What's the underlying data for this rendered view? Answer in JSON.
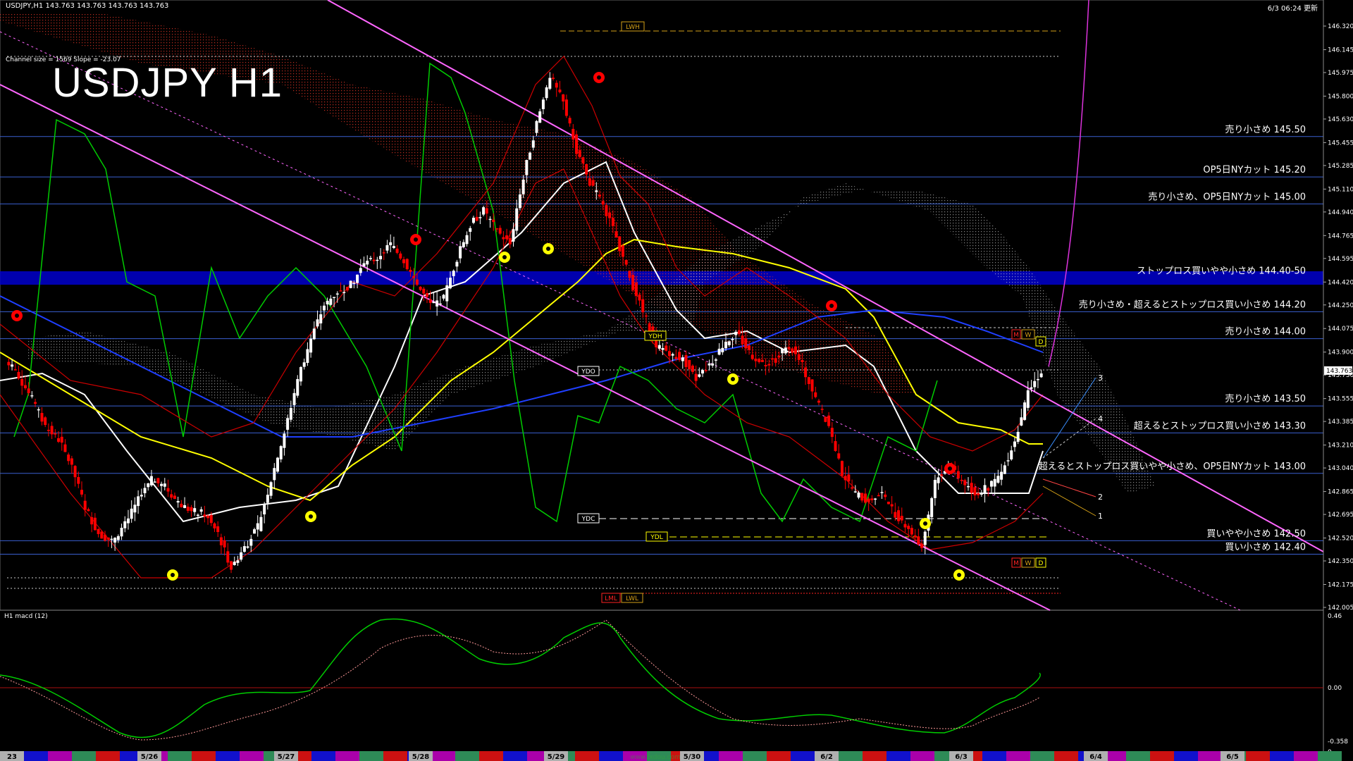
{
  "header": {
    "symbol_info": "USDJPY,H1  143.763 143.763 143.763 143.763",
    "timestamp": "6/3 06:24 更新"
  },
  "overlay": {
    "title": "USDJPY H1",
    "channel_info": "Channel size = 1569 Slope = -23.07",
    "macd_title": "H1  macd (12)"
  },
  "colors": {
    "background": "#000000",
    "bull": "#ffffff",
    "bear": "#ff0000",
    "level_line": "#2a4fbf",
    "band": "#0000cc",
    "channel": "#ff66ff",
    "ma_white": "#ffffff",
    "ma_yellow": "#ffff00",
    "ma_blue": "#1f3fff",
    "cloud_red": "#ff3a2a",
    "cloud_white": "#e0e0e0",
    "lagging": "#00cc00",
    "bollinger": "#cc0000"
  },
  "price_axis": {
    "ticks": [
      "146.320",
      "146.145",
      "145.975",
      "145.800",
      "145.630",
      "145.455",
      "145.285",
      "145.110",
      "144.940",
      "144.765",
      "144.595",
      "144.420",
      "144.250",
      "144.075",
      "143.900",
      "143.730",
      "143.555",
      "143.385",
      "143.210",
      "143.040",
      "142.865",
      "142.695",
      "142.520",
      "142.350",
      "142.175",
      "142.005"
    ],
    "current_price": "143.763"
  },
  "macd_axis": {
    "ticks": [
      "0.46",
      "0.00",
      "-0.358",
      "0"
    ]
  },
  "date_axis": {
    "labels": [
      "23",
      "5/26",
      "5/27",
      "5/28",
      "5/29",
      "5/30",
      "6/2",
      "6/3",
      "6/4",
      "6/5"
    ],
    "faded_label": "www.fxdou.com"
  },
  "levels": [
    {
      "label": "売り小さめ 145.50",
      "price": 145.5
    },
    {
      "label": "OP5日NYカット 145.20",
      "price": 145.2
    },
    {
      "label": "売り小さめ、OP5日NYカット 145.00",
      "price": 145.0
    },
    {
      "label": "ストップロス買いやや小さめ 144.40-50",
      "price": 144.45
    },
    {
      "label": "売り小さめ・超えるとストップロス買い小さめ 144.20",
      "price": 144.2
    },
    {
      "label": "売り小さめ 144.00",
      "price": 144.0
    },
    {
      "label": "売り小さめ 143.50",
      "price": 143.5
    },
    {
      "label": "超えるとストップロス買い小さめ 143.30",
      "price": 143.3
    },
    {
      "label": "超えるとストップロス買いやや小さめ、OP5日NYカット 143.00",
      "price": 143.0
    },
    {
      "label": "買いやや小さめ 142.50",
      "price": 142.5
    },
    {
      "label": "買い小さめ 142.40",
      "price": 142.4
    }
  ],
  "tags": {
    "LWH": "LWH",
    "YDH": "YDH",
    "YDO": "YDO",
    "YDC": "YDC",
    "YDL": "YDL",
    "LML": "LML",
    "LWL": "LWL",
    "M": "M",
    "W": "W",
    "D": "D"
  },
  "projection_labels": [
    "3",
    "4",
    "2",
    "1"
  ],
  "chart_data": {
    "type": "candlestick",
    "timeframe": "H1",
    "symbol": "USDJPY",
    "ylim": [
      142.005,
      146.32
    ],
    "sessions": [
      "5/23",
      "5/26",
      "5/27",
      "5/28",
      "5/29",
      "5/30",
      "6/2",
      "6/3"
    ],
    "close_path": [
      143.85,
      143.72,
      143.55,
      143.35,
      143.25,
      143.05,
      142.75,
      142.55,
      142.5,
      142.62,
      142.8,
      142.95,
      142.9,
      142.78,
      142.72,
      142.7,
      142.55,
      142.3,
      142.45,
      142.6,
      142.95,
      143.3,
      143.7,
      144.0,
      144.25,
      144.35,
      144.4,
      144.55,
      144.6,
      144.7,
      144.58,
      144.4,
      144.25,
      144.3,
      144.6,
      144.85,
      144.95,
      144.8,
      144.7,
      145.2,
      145.6,
      145.95,
      145.75,
      145.4,
      145.15,
      145.0,
      144.75,
      144.45,
      144.2,
      143.95,
      143.9,
      143.85,
      143.7,
      143.8,
      143.95,
      144.05,
      143.9,
      143.8,
      143.85,
      143.95,
      143.8,
      143.55,
      143.35,
      143.0,
      142.85,
      142.8,
      142.85,
      142.7,
      142.6,
      142.45,
      142.95,
      143.05,
      142.95,
      142.85,
      142.9,
      143.0,
      143.25,
      143.6,
      143.76
    ]
  }
}
